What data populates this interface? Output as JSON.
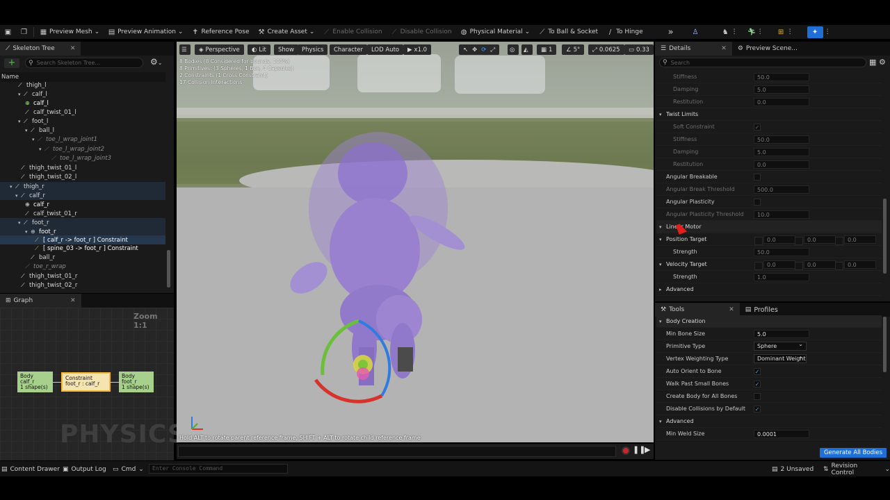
{
  "toolbar": {
    "preview_mesh": "Preview Mesh",
    "preview_animation": "Preview Animation",
    "reference_pose": "Reference Pose",
    "create_asset": "Create Asset",
    "enable_collision": "Enable Collision",
    "disable_collision": "Disable Collision",
    "physical_material": "Physical Material",
    "to_ball_socket": "To Ball & Socket",
    "to_hinge": "To Hinge"
  },
  "skeleton_tree": {
    "tab_title": "Skeleton Tree",
    "search_placeholder": "Search Skeleton Tree...",
    "column_name": "Name",
    "rows": [
      {
        "label": "thigh_l"
      },
      {
        "label": "calf_l"
      },
      {
        "label": "calf_l"
      },
      {
        "label": "calf_twist_01_l"
      },
      {
        "label": "foot_l"
      },
      {
        "label": "ball_l"
      },
      {
        "label": "toe_l_wrap_joint1"
      },
      {
        "label": "toe_l_wrap_joint2"
      },
      {
        "label": "toe_l_wrap_joint3"
      },
      {
        "label": "thigh_twist_01_l"
      },
      {
        "label": "thigh_twist_02_l"
      },
      {
        "label": "thigh_r"
      },
      {
        "label": "calf_r"
      },
      {
        "label": "calf_r"
      },
      {
        "label": "calf_twist_01_r"
      },
      {
        "label": "foot_r"
      },
      {
        "label": "foot_r"
      },
      {
        "label": "[ calf_r -> foot_r ] Constraint"
      },
      {
        "label": "[ spine_03 -> foot_r ] Constraint"
      },
      {
        "label": "ball_r"
      },
      {
        "label": "toe_r_wrap"
      },
      {
        "label": "thigh_twist_01_r"
      },
      {
        "label": "thigh_twist_02_r"
      }
    ]
  },
  "graph": {
    "tab_title": "Graph",
    "zoom": "Zoom 1:1",
    "watermark": "PHYSICS",
    "nodes": [
      {
        "line1": "Body",
        "line2": "calf_r",
        "line3": "1 shape(s)"
      },
      {
        "line1": "Constraint",
        "line2": "foot_r : calf_r",
        "line3": ""
      },
      {
        "line1": "Body",
        "line2": "foot_r",
        "line3": "1 shape(s)"
      }
    ]
  },
  "viewport": {
    "perspective": "Perspective",
    "lit": "Lit",
    "show": "Show",
    "physics": "Physics",
    "character": "Character",
    "lod": "LOD Auto",
    "speed": "x1.0",
    "grid": "1",
    "angle": "5°",
    "scale": "0.0625",
    "camera": "0.33",
    "stats": [
      "8 Bodies (8 Considered for bounds, 100%)",
      "8 Primitives: (3 Spheres, 1 Box, 4 Capsules)",
      "2 Constraints (1 Cross Constraint)",
      "17 Collision Interactions"
    ],
    "hint": "Hold ALT to rotate parent reference frame, SHIFT + ALT to rotate child reference frame"
  },
  "details": {
    "tab_title": "Details",
    "preview_tab": "Preview Scene...",
    "search_placeholder": "Search",
    "rows": [
      {
        "label": "Stiffness",
        "value": "50.0"
      },
      {
        "label": "Damping",
        "value": "5.0"
      },
      {
        "label": "Restitution",
        "value": "0.0"
      },
      {
        "label": "Twist Limits",
        "value": ""
      },
      {
        "label": "Soft Constraint",
        "value": ""
      },
      {
        "label": "Stiffness",
        "value": "50.0"
      },
      {
        "label": "Damping",
        "value": "5.0"
      },
      {
        "label": "Restitution",
        "value": "0.0"
      },
      {
        "label": "Angular Breakable",
        "value": ""
      },
      {
        "label": "Angular Break Threshold",
        "value": "500.0"
      },
      {
        "label": "Angular Plasticity",
        "value": ""
      },
      {
        "label": "Angular Plasticity Threshold",
        "value": "10.0"
      },
      {
        "label": "Linear Motor",
        "value": ""
      },
      {
        "label": "Position Target",
        "value": "0.0"
      },
      {
        "label": "Strength",
        "value": "50.0"
      },
      {
        "label": "Velocity Target",
        "value": "0.0"
      },
      {
        "label": "Strength",
        "value": "1.0"
      },
      {
        "label": "Advanced",
        "value": ""
      }
    ]
  },
  "tools": {
    "tab_title": "Tools",
    "profiles_tab": "Profiles",
    "section": "Body Creation",
    "rows": [
      {
        "label": "Min Bone Size",
        "value": "5.0"
      },
      {
        "label": "Primitive Type",
        "value": "Sphere"
      },
      {
        "label": "Vertex Weighting Type",
        "value": "Dominant Weight"
      },
      {
        "label": "Auto Orient to Bone",
        "value": ""
      },
      {
        "label": "Walk Past Small Bones",
        "value": ""
      },
      {
        "label": "Create Body for All Bones",
        "value": ""
      },
      {
        "label": "Disable Collisions by Default",
        "value": ""
      },
      {
        "label": "Advanced",
        "value": ""
      },
      {
        "label": "Min Weld Size",
        "value": "0.0001"
      }
    ],
    "generate_button": "Generate All Bodies"
  },
  "bottom": {
    "content_drawer": "Content Drawer",
    "output_log": "Output Log",
    "cmd": "Cmd",
    "console_placeholder": "Enter Console Command",
    "unsaved": "2 Unsaved",
    "revision_control": "Revision Control"
  },
  "colors": {
    "accent": "#1f6fd6",
    "graph_node": "#a8d08d",
    "constraint_node": "#f5b830"
  }
}
